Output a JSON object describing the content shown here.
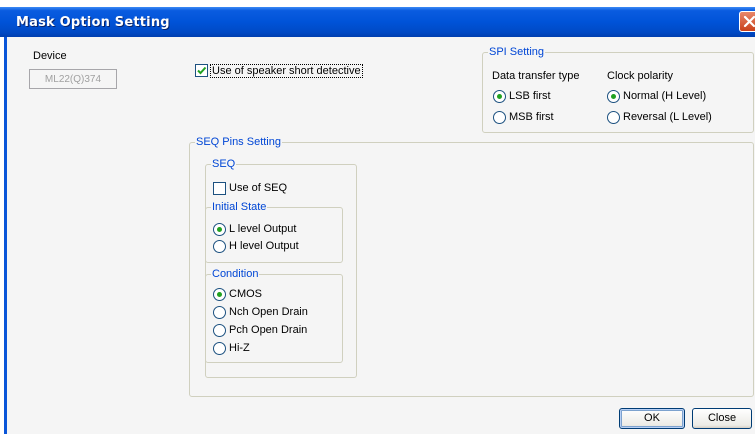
{
  "window": {
    "title": "Mask Option Setting"
  },
  "device": {
    "label": "Device",
    "value": "ML22(Q)374"
  },
  "speaker_short": {
    "label": "Use of speaker short detective",
    "checked": true
  },
  "spi": {
    "title": "SPI Setting",
    "data_transfer": {
      "label": "Data transfer type",
      "options": [
        "LSB first",
        "MSB first"
      ],
      "selected": 0
    },
    "clock_polarity": {
      "label": "Clock polarity",
      "options": [
        "Normal (H Level)",
        "Reversal (L Level)"
      ],
      "selected": 0
    }
  },
  "seq_pins": {
    "title": "SEQ Pins Setting",
    "seq": {
      "title": "SEQ",
      "use_label": "Use of SEQ",
      "use_checked": false,
      "initial_state": {
        "title": "Initial State",
        "options": [
          "L level Output",
          "H level Output"
        ],
        "selected": 0
      },
      "condition": {
        "title": "Condition",
        "options": [
          "CMOS",
          "Nch Open Drain",
          "Pch Open Drain",
          "Hi-Z"
        ],
        "selected": 0
      }
    }
  },
  "buttons": {
    "ok": "OK",
    "close": "Close"
  },
  "colors": {
    "titlebar": "#0053d8",
    "group_title": "#0046d5",
    "radio_dot": "#21a121",
    "check_mark": "#21a121"
  }
}
